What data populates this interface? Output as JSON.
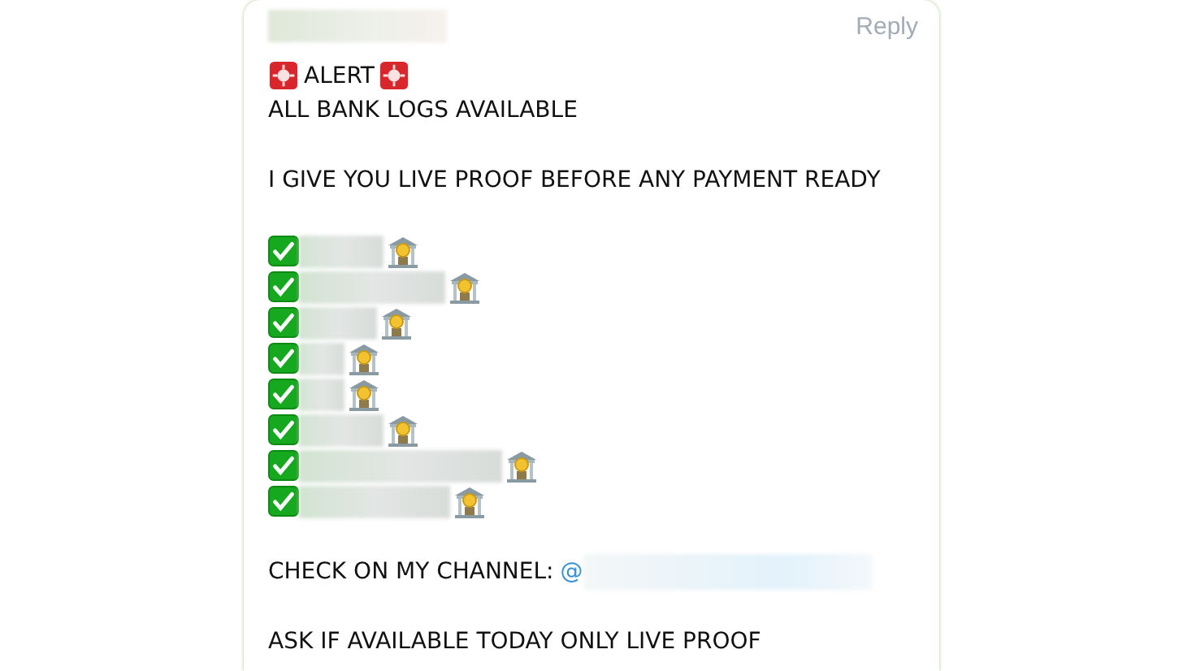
{
  "message": {
    "reply_label": "Reply",
    "paragraphs": [
      {
        "lines": [
          {
            "kind": "alert",
            "text": "ALERT"
          },
          {
            "kind": "text",
            "text": "ALL BANK LOGS AVAILABLE"
          }
        ]
      },
      {
        "lines": [
          {
            "kind": "text",
            "text": "I GIVE YOU LIVE PROOF BEFORE ANY PAYMENT READY"
          }
        ]
      },
      {
        "lines": [
          {
            "kind": "checklist",
            "items": [
              {
                "checked": true
              },
              {
                "checked": true
              },
              {
                "checked": true
              },
              {
                "checked": true
              },
              {
                "checked": true
              },
              {
                "checked": true
              },
              {
                "checked": true
              },
              {
                "checked": true
              }
            ]
          }
        ]
      },
      {
        "lines": [
          {
            "kind": "mention",
            "text": "CHECK ON MY CHANNEL:",
            "mention": "@"
          }
        ]
      },
      {
        "lines": [
          {
            "kind": "text",
            "text": "ASK IF AVAILABLE TODAY ONLY LIVE PROOF"
          }
        ]
      }
    ]
  }
}
